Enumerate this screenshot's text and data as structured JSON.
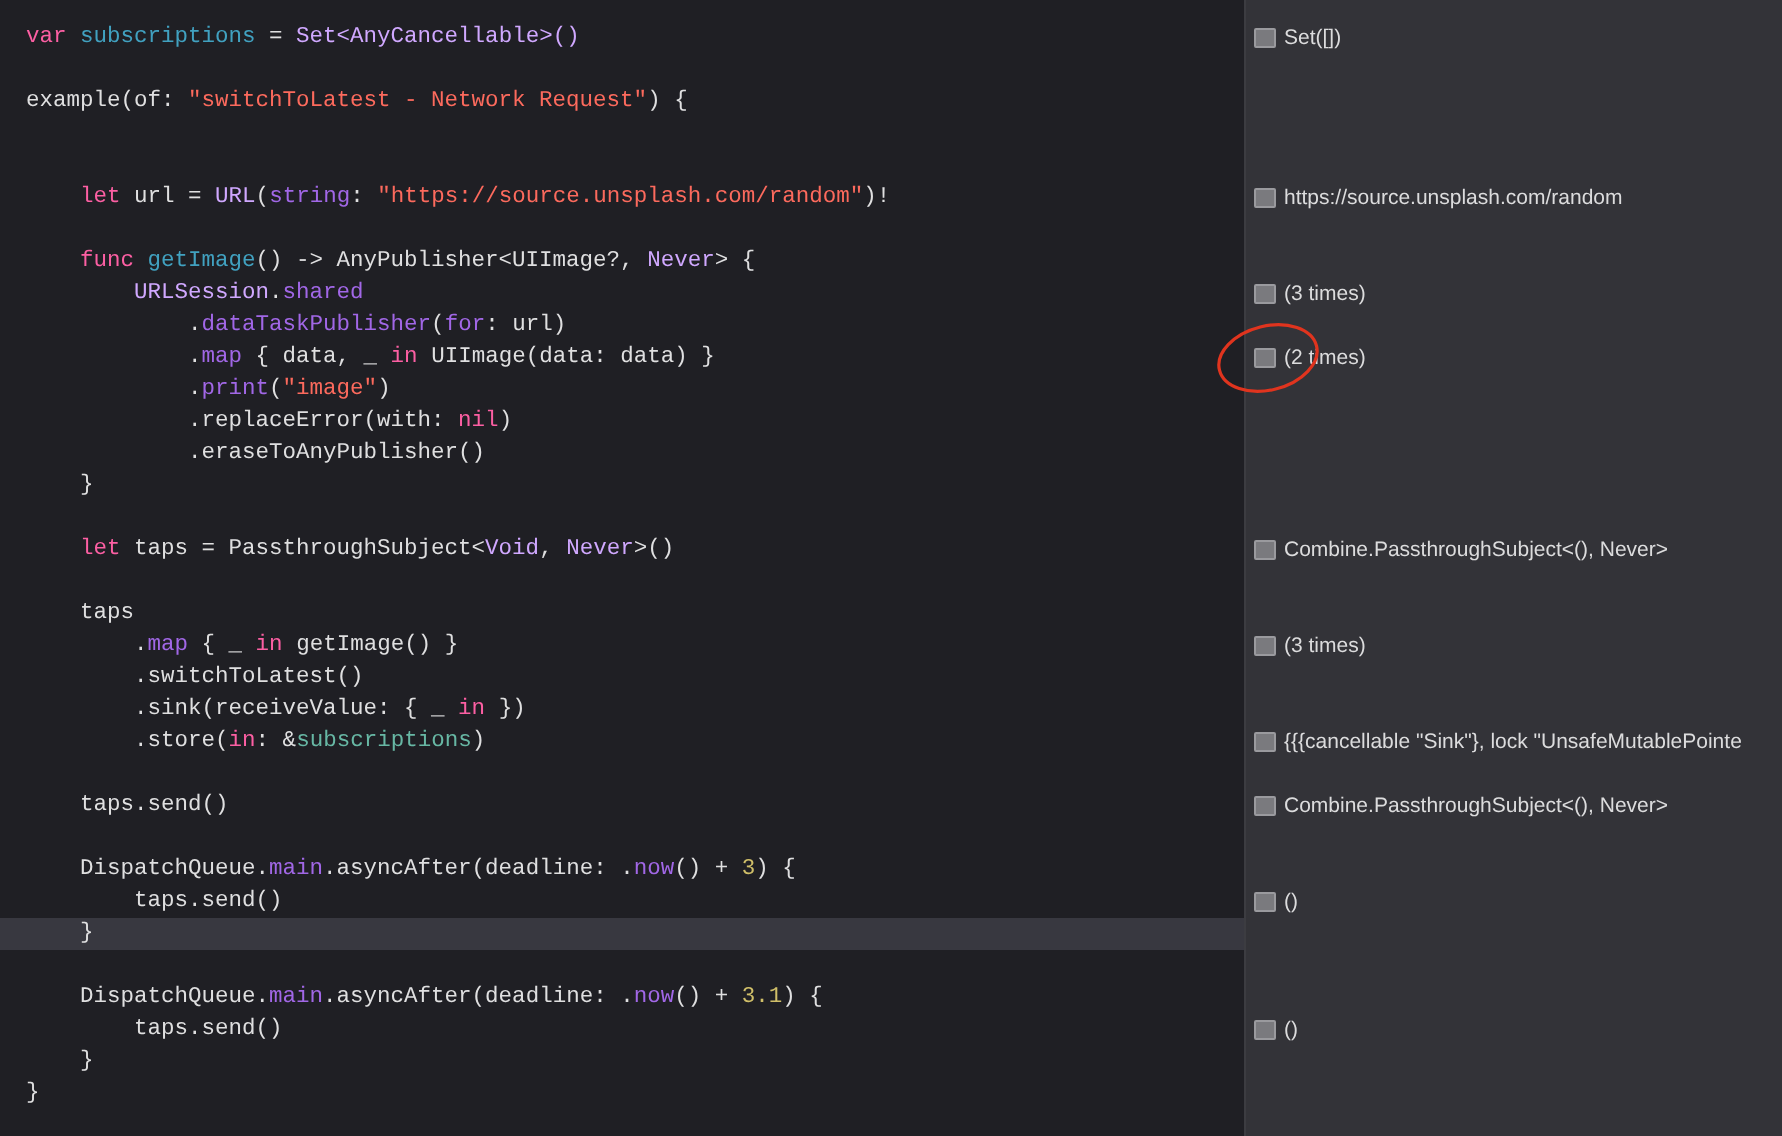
{
  "lines": [
    {
      "highlighted": false,
      "circled": false,
      "tokens": [
        {
          "kind": "keyword",
          "text": "var "
        },
        {
          "kind": "decl",
          "text": "subscriptions"
        },
        {
          "kind": "plain",
          "text": " = "
        },
        {
          "kind": "type",
          "text": "Set<AnyCancellable>()"
        }
      ],
      "result": "Set([])"
    },
    {
      "highlighted": false,
      "circled": false
    },
    {
      "highlighted": false,
      "circled": false,
      "tokens": [
        {
          "kind": "plain",
          "text": "example(of: "
        },
        {
          "kind": "string",
          "text": "\"switchToLatest - Network Request\""
        },
        {
          "kind": "plain",
          "text": ") {"
        }
      ]
    },
    {
      "highlighted": false,
      "circled": false
    },
    {
      "highlighted": false,
      "circled": false
    },
    {
      "highlighted": false,
      "circled": false,
      "tokens": [
        {
          "kind": "keyword",
          "text": "    let"
        },
        {
          "kind": "plain",
          "text": " url = "
        },
        {
          "kind": "type",
          "text": "URL"
        },
        {
          "kind": "plain",
          "text": "("
        },
        {
          "kind": "member",
          "text": "string"
        },
        {
          "kind": "plain",
          "text": ": "
        },
        {
          "kind": "string",
          "text": "\"https://source.unsplash.com/random\""
        },
        {
          "kind": "plain",
          "text": ")!"
        }
      ],
      "result": "https://source.unsplash.com/random"
    },
    {
      "highlighted": false,
      "circled": false
    },
    {
      "highlighted": false,
      "circled": false,
      "tokens": [
        {
          "kind": "keyword",
          "text": "    func "
        },
        {
          "kind": "decl",
          "text": "getImage"
        },
        {
          "kind": "plain",
          "text": "() -> AnyPublisher<UIImage?, "
        },
        {
          "kind": "type",
          "text": "Never"
        },
        {
          "kind": "plain",
          "text": "> {"
        }
      ]
    },
    {
      "highlighted": false,
      "circled": false,
      "tokens": [
        {
          "kind": "type",
          "text": "        URLSession"
        },
        {
          "kind": "plain",
          "text": "."
        },
        {
          "kind": "member",
          "text": "shared"
        }
      ],
      "result": "(3 times)"
    },
    {
      "highlighted": false,
      "circled": false,
      "tokens": [
        {
          "kind": "plain",
          "text": "            ."
        },
        {
          "kind": "member",
          "text": "dataTaskPublisher"
        },
        {
          "kind": "plain",
          "text": "("
        },
        {
          "kind": "member",
          "text": "for"
        },
        {
          "kind": "plain",
          "text": ": url)"
        }
      ]
    },
    {
      "highlighted": false,
      "circled": true,
      "tokens": [
        {
          "kind": "plain",
          "text": "            ."
        },
        {
          "kind": "member",
          "text": "map"
        },
        {
          "kind": "plain",
          "text": " { data, _ "
        },
        {
          "kind": "keyword",
          "text": "in"
        },
        {
          "kind": "plain",
          "text": " UIImage(data: data) }"
        }
      ],
      "result": "(2 times)"
    },
    {
      "highlighted": false,
      "circled": false,
      "tokens": [
        {
          "kind": "plain",
          "text": "            ."
        },
        {
          "kind": "member",
          "text": "print"
        },
        {
          "kind": "plain",
          "text": "("
        },
        {
          "kind": "string",
          "text": "\"image\""
        },
        {
          "kind": "plain",
          "text": ")"
        }
      ]
    },
    {
      "highlighted": false,
      "circled": false,
      "tokens": [
        {
          "kind": "plain",
          "text": "            .replaceError(with: "
        },
        {
          "kind": "keyword",
          "text": "nil"
        },
        {
          "kind": "plain",
          "text": ")"
        }
      ]
    },
    {
      "highlighted": false,
      "circled": false,
      "tokens": [
        {
          "kind": "plain",
          "text": "            .eraseToAnyPublisher()"
        }
      ]
    },
    {
      "highlighted": false,
      "circled": false,
      "tokens": [
        {
          "kind": "plain",
          "text": "    }"
        }
      ]
    },
    {
      "highlighted": false,
      "circled": false
    },
    {
      "highlighted": false,
      "circled": false,
      "tokens": [
        {
          "kind": "keyword",
          "text": "    let"
        },
        {
          "kind": "plain",
          "text": " taps = PassthroughSubject<"
        },
        {
          "kind": "type",
          "text": "Void"
        },
        {
          "kind": "plain",
          "text": ", "
        },
        {
          "kind": "type",
          "text": "Never"
        },
        {
          "kind": "plain",
          "text": ">()"
        }
      ],
      "result": "Combine.PassthroughSubject<(), Never>"
    },
    {
      "highlighted": false,
      "circled": false
    },
    {
      "highlighted": false,
      "circled": false,
      "tokens": [
        {
          "kind": "plain",
          "text": "    taps"
        }
      ]
    },
    {
      "highlighted": false,
      "circled": false,
      "tokens": [
        {
          "kind": "plain",
          "text": "        ."
        },
        {
          "kind": "member",
          "text": "map"
        },
        {
          "kind": "plain",
          "text": " { _ "
        },
        {
          "kind": "keyword",
          "text": "in"
        },
        {
          "kind": "plain",
          "text": " getImage() }"
        }
      ],
      "result": "(3 times)"
    },
    {
      "highlighted": false,
      "circled": false,
      "tokens": [
        {
          "kind": "plain",
          "text": "        .switchToLatest()"
        }
      ]
    },
    {
      "highlighted": false,
      "circled": false,
      "tokens": [
        {
          "kind": "plain",
          "text": "        .sink(receiveValue: { _ "
        },
        {
          "kind": "keyword",
          "text": "in"
        },
        {
          "kind": "plain",
          "text": " })"
        }
      ]
    },
    {
      "highlighted": false,
      "circled": false,
      "tokens": [
        {
          "kind": "plain",
          "text": "        .store("
        },
        {
          "kind": "keyword",
          "text": "in"
        },
        {
          "kind": "plain",
          "text": ": &"
        },
        {
          "kind": "local",
          "text": "subscriptions"
        },
        {
          "kind": "plain",
          "text": ")"
        }
      ],
      "result": "{{{cancellable \"Sink\"}, lock \"UnsafeMutablePointe"
    },
    {
      "highlighted": false,
      "circled": false
    },
    {
      "highlighted": false,
      "circled": false,
      "tokens": [
        {
          "kind": "plain",
          "text": "    taps.send()"
        }
      ],
      "result": "Combine.PassthroughSubject<(), Never>"
    },
    {
      "highlighted": false,
      "circled": false
    },
    {
      "highlighted": false,
      "circled": false,
      "tokens": [
        {
          "kind": "plain",
          "text": "    DispatchQueue."
        },
        {
          "kind": "member",
          "text": "main"
        },
        {
          "kind": "plain",
          "text": ".asyncAfter(deadline: ."
        },
        {
          "kind": "member",
          "text": "now"
        },
        {
          "kind": "plain",
          "text": "() + "
        },
        {
          "kind": "number",
          "text": "3"
        },
        {
          "kind": "plain",
          "text": ") {"
        }
      ]
    },
    {
      "highlighted": false,
      "circled": false,
      "tokens": [
        {
          "kind": "plain",
          "text": "        taps.send()"
        }
      ],
      "result": "()"
    },
    {
      "highlighted": true,
      "circled": false,
      "tokens": [
        {
          "kind": "plain",
          "text": "    }"
        }
      ]
    },
    {
      "highlighted": false,
      "circled": false
    },
    {
      "highlighted": false,
      "circled": false,
      "tokens": [
        {
          "kind": "plain",
          "text": "    DispatchQueue."
        },
        {
          "kind": "member",
          "text": "main"
        },
        {
          "kind": "plain",
          "text": ".asyncAfter(deadline: ."
        },
        {
          "kind": "member",
          "text": "now"
        },
        {
          "kind": "plain",
          "text": "() + "
        },
        {
          "kind": "number",
          "text": "3.1"
        },
        {
          "kind": "plain",
          "text": ") {"
        }
      ]
    },
    {
      "highlighted": false,
      "circled": false,
      "tokens": [
        {
          "kind": "plain",
          "text": "        taps.send()"
        }
      ],
      "result": "()"
    },
    {
      "highlighted": false,
      "circled": false,
      "tokens": [
        {
          "kind": "plain",
          "text": "    }"
        }
      ]
    },
    {
      "highlighted": false,
      "circled": false,
      "tokens": [
        {
          "kind": "plain",
          "text": "}"
        }
      ]
    }
  ]
}
